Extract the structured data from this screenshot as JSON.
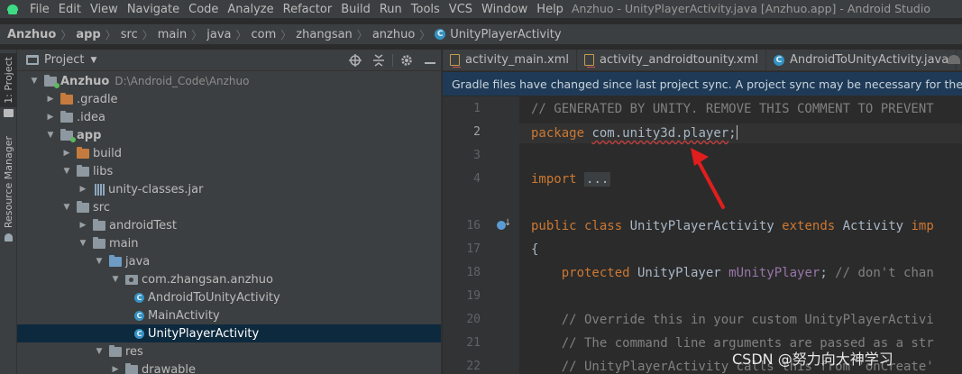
{
  "menu": {
    "items": [
      "File",
      "Edit",
      "View",
      "Navigate",
      "Code",
      "Analyze",
      "Refactor",
      "Build",
      "Run",
      "Tools",
      "VCS",
      "Window",
      "Help"
    ],
    "window_title": "Anzhuo - UnityPlayerActivity.java [Anzhuo.app] - Android Studio"
  },
  "breadcrumb": [
    "Anzhuo",
    "app",
    "src",
    "main",
    "java",
    "com",
    "zhangsan",
    "anzhuo",
    "UnityPlayerActivity"
  ],
  "left_strip": {
    "project_tab": "1: Project",
    "resource_tab": "Resource Manager"
  },
  "project_panel": {
    "title": "Project",
    "tools": [
      "crosshair-icon",
      "collapse-icon",
      "gear-icon",
      "hide-icon"
    ],
    "tree": [
      {
        "label": "Anzhuo",
        "path": "D:\\Android_Code\\Anzhuo",
        "depth": 0,
        "expanded": true,
        "icon": "module-folder",
        "bold": true
      },
      {
        "label": ".gradle",
        "depth": 1,
        "expanded": false,
        "icon": "orange-folder"
      },
      {
        "label": ".idea",
        "depth": 1,
        "expanded": false,
        "icon": "folder"
      },
      {
        "label": "app",
        "depth": 1,
        "expanded": true,
        "icon": "module-folder",
        "bold": true
      },
      {
        "label": "build",
        "depth": 2,
        "expanded": false,
        "icon": "orange-folder"
      },
      {
        "label": "libs",
        "depth": 2,
        "expanded": true,
        "icon": "folder"
      },
      {
        "label": "unity-classes.jar",
        "depth": 3,
        "expanded": false,
        "icon": "jar"
      },
      {
        "label": "src",
        "depth": 2,
        "expanded": true,
        "icon": "folder"
      },
      {
        "label": "androidTest",
        "depth": 3,
        "expanded": false,
        "icon": "folder"
      },
      {
        "label": "main",
        "depth": 3,
        "expanded": true,
        "icon": "folder"
      },
      {
        "label": "java",
        "depth": 4,
        "expanded": true,
        "icon": "blue-folder"
      },
      {
        "label": "com.zhangsan.anzhuo",
        "depth": 5,
        "expanded": true,
        "icon": "package"
      },
      {
        "label": "AndroidToUnityActivity",
        "depth": 6,
        "icon": "class"
      },
      {
        "label": "MainActivity",
        "depth": 6,
        "icon": "class"
      },
      {
        "label": "UnityPlayerActivity",
        "depth": 6,
        "icon": "class",
        "selected": true
      },
      {
        "label": "res",
        "depth": 4,
        "expanded": true,
        "icon": "folder"
      },
      {
        "label": "drawable",
        "depth": 5,
        "expanded": false,
        "icon": "folder"
      }
    ]
  },
  "tabs": [
    {
      "label": "activity_main.xml",
      "icon": "xml-file-icon"
    },
    {
      "label": "activity_androidtounity.xml",
      "icon": "xml-file-icon"
    },
    {
      "label": "AndroidToUnityActivity.java",
      "icon": "class-icon"
    }
  ],
  "notice": "Gradle files have changed since last project sync. A project sync may be necessary for the IDE to",
  "editor": {
    "lines": [
      {
        "num": "1",
        "text": "// GENERATED BY UNITY. REMOVE THIS COMMENT TO PREVENT"
      },
      {
        "num": "2",
        "text": "package com.unity3d.player;",
        "current": true
      },
      {
        "num": "3",
        "text": ""
      },
      {
        "num": "4",
        "text": "import ..."
      },
      {
        "num": "16",
        "text": "public class UnityPlayerActivity extends Activity imp"
      },
      {
        "num": "17",
        "text": "{"
      },
      {
        "num": "18",
        "text": "    protected UnityPlayer mUnityPlayer; // don't chan"
      },
      {
        "num": "19",
        "text": ""
      },
      {
        "num": "20",
        "text": "    // Override this in your custom UnityPlayerActivi"
      },
      {
        "num": "21",
        "text": "    // The command line arguments are passed as a str"
      },
      {
        "num": "22",
        "text": "    // UnityPlayerActivity calls this from 'onCreate'"
      }
    ]
  },
  "watermark": "CSDN @努力向大神学习"
}
